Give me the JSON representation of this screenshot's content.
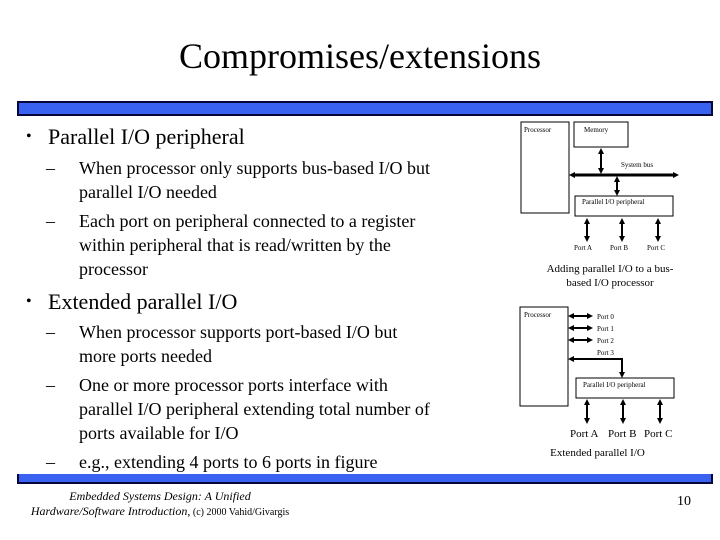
{
  "slide": {
    "title": "Compromises/extensions",
    "page_number": "10",
    "accent_color": "#3a62f0",
    "bar_border_color": "#06063a"
  },
  "bullets": [
    {
      "text": "Parallel I/O peripheral",
      "subs": [
        [
          "When processor only supports bus-based I/O but",
          "parallel I/O needed"
        ],
        [
          "Each port on peripheral connected to a register",
          "within peripheral that is read/written by the",
          "processor"
        ]
      ]
    },
    {
      "text": "Extended parallel I/O",
      "subs": [
        [
          "When processor supports port-based I/O but",
          "more ports needed"
        ],
        [
          "One or more processor ports interface with",
          "parallel I/O peripheral extending total number of",
          "ports available for I/O"
        ],
        [
          "e.g., extending 4 ports to 6 ports in figure"
        ]
      ]
    }
  ],
  "bullet_glyph": "•",
  "dash_glyph": "–",
  "diagram1": {
    "processor": "Processor",
    "memory": "Memory",
    "system_bus": "System bus",
    "peripheral": "Parallel I/O peripheral",
    "ports": [
      "Port A",
      "Port B",
      "Port C"
    ],
    "caption_line1": "Adding parallel I/O to a bus-",
    "caption_line2": "based I/O processor"
  },
  "diagram2": {
    "processor": "Processor",
    "cpu_ports": [
      "Port 0",
      "Port 1",
      "Port 2",
      "Port 3"
    ],
    "peripheral": "Parallel I/O peripheral",
    "ports": [
      "Port A",
      "Port B",
      "Port C"
    ],
    "caption": "Extended parallel I/O"
  },
  "footer": {
    "line1": "Embedded Systems Design: A Unified",
    "line2_italic": "Hardware/Software Introduction,",
    "line2_plain": " (c) 2000 Vahid/Givargis"
  }
}
